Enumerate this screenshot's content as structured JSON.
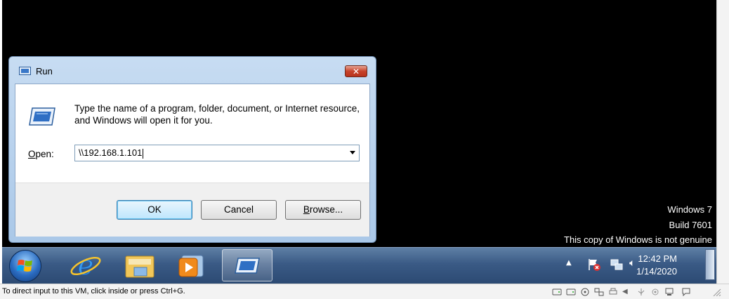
{
  "dialog": {
    "title": "Run",
    "description": "Type the name of a program, folder, document, or Internet resource, and Windows will open it for you.",
    "open_label": "Open:",
    "open_value": "\\\\192.168.1.101",
    "ok_label": "OK",
    "cancel_label": "Cancel",
    "browse_label": "Browse...",
    "close_icon": "close-icon"
  },
  "watermark": {
    "line1": "Windows 7",
    "line2": "Build 7601",
    "line3": "This copy of Windows is not genuine"
  },
  "taskbar": {
    "pinned": [
      {
        "icon": "start-orb-icon"
      },
      {
        "icon": "internet-explorer-icon"
      },
      {
        "icon": "windows-explorer-icon"
      },
      {
        "icon": "media-player-icon"
      },
      {
        "icon": "run-dialog-icon"
      }
    ],
    "clock_time": "12:42 PM",
    "clock_date": "1/14/2020"
  },
  "statusbar": {
    "text": "To direct input to this VM, click inside or press Ctrl+G."
  },
  "colors": {
    "taskbar": "#3a5a85",
    "close_button": "#c7432a",
    "ok_button_border": "#3c7fb1"
  }
}
